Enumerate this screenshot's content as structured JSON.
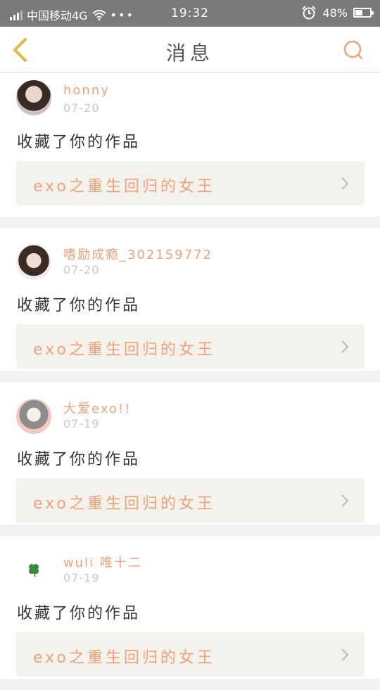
{
  "status_bar": {
    "carrier": "中国移动4G",
    "more": "•••",
    "time": "19:32",
    "battery": "48%",
    "battery_level": 0.48
  },
  "navbar": {
    "title": "消息",
    "icons": {
      "back": "chevron-left-icon",
      "search": "search-icon"
    }
  },
  "colors": {
    "accent": "#f0a27a",
    "back_icon": "#e2b93b"
  },
  "messages": [
    {
      "user": "honny",
      "date": "07-20",
      "action": "收藏了你的作品",
      "work": "exo之重生回归的女王",
      "avatar": "avatar-1"
    },
    {
      "user": "嗜励成瘾_302159772",
      "date": "07-20",
      "action": "收藏了你的作品",
      "work": "exo之重生回归的女王",
      "avatar": "avatar-2"
    },
    {
      "user": "大爱exo!!",
      "date": "07-19",
      "action": "收藏了你的作品",
      "work": "exo之重生回归的女王",
      "avatar": "avatar-3"
    },
    {
      "user": "wuli       唯十二",
      "date": "07-19",
      "action": "收藏了你的作品",
      "work": "exo之重生回归的女王",
      "avatar": "avatar-4"
    }
  ]
}
